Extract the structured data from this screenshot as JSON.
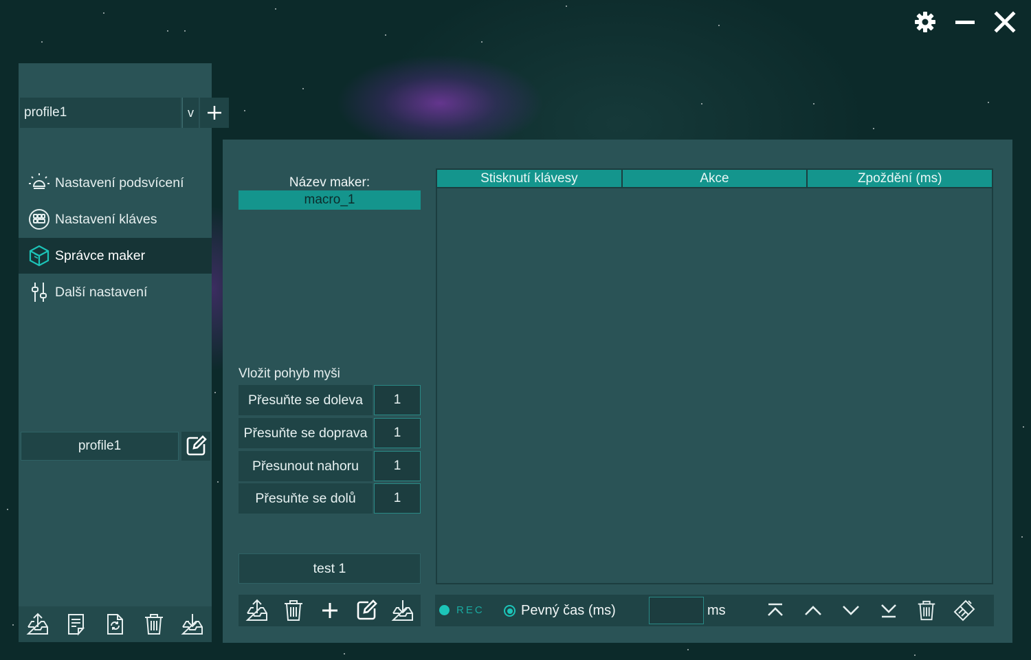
{
  "window": {
    "settings_icon": "gear-icon",
    "minimize_icon": "minimize-icon",
    "close_icon": "close-icon"
  },
  "sidebar": {
    "profile_selected": "profile1",
    "profile_dropdown_arrow": "v",
    "add_profile_icon": "plus-icon",
    "nav": [
      {
        "label": "Nastavení podsvícení",
        "icon": "light-bulb-icon",
        "active": false
      },
      {
        "label": "Nastavení kláves",
        "icon": "keyboard-icon",
        "active": false
      },
      {
        "label": "Správce maker",
        "icon": "cube-icon",
        "active": true
      },
      {
        "label": "Další nastavení",
        "icon": "sliders-icon",
        "active": false
      }
    ],
    "profile_name": "profile1",
    "edit_icon": "edit-icon",
    "toolbar_icons": [
      "export-icon",
      "notes-icon",
      "refresh-file-icon",
      "trash-icon",
      "import-icon"
    ]
  },
  "macro": {
    "name_label": "Název maker:",
    "name_value": "macro_1",
    "mouse_section_title": "Vložit pohyb myši",
    "moves": [
      {
        "label": "Přesuňte se doleva",
        "value": "1"
      },
      {
        "label": "Přesuňte se doprava",
        "value": "1"
      },
      {
        "label": "Přesunout nahoru",
        "value": "1"
      },
      {
        "label": "Přesuňte se dolů",
        "value": "1"
      }
    ],
    "list_item": "test 1",
    "toolbar_icons": [
      "export-icon",
      "trash-icon",
      "plus-icon",
      "edit-icon",
      "import-icon"
    ]
  },
  "table": {
    "columns": [
      "Stisknutí klávesy",
      "Akce",
      "Zpoždění (ms)"
    ],
    "rows": []
  },
  "bottom_bar": {
    "rec_label": "REC",
    "fixed_time_label": "Pevný čas (ms)",
    "ms_value": "",
    "ms_label": "ms",
    "order_icons": [
      "move-top-icon",
      "move-up-icon",
      "move-down-icon",
      "move-bottom-icon",
      "trash-icon",
      "eraser-icon"
    ]
  },
  "colors": {
    "accent": "#14958d",
    "panel": "#2a5356",
    "dark_panel": "#1f4446",
    "background": "#0c2a2a"
  }
}
